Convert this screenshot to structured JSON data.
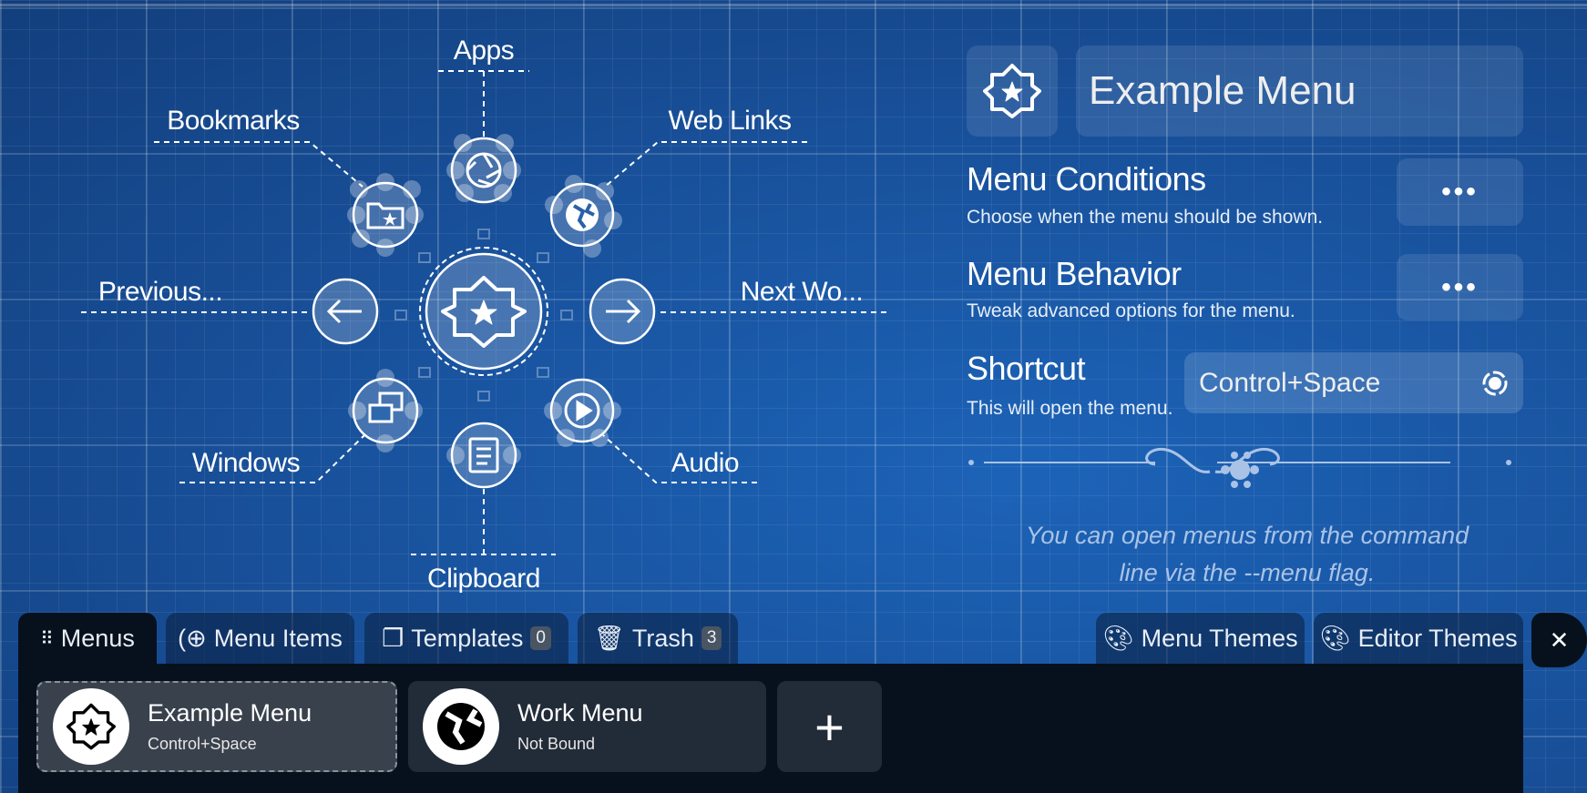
{
  "pie": {
    "center_icon": "star-badge-icon",
    "items": [
      {
        "label": "Apps",
        "icon": "shutter-icon"
      },
      {
        "label": "Web Links",
        "icon": "globe-icon"
      },
      {
        "label": "Next Wo...",
        "icon": "arrow-right-icon"
      },
      {
        "label": "Audio",
        "icon": "play-circle-icon"
      },
      {
        "label": "Clipboard",
        "icon": "clipboard-icon"
      },
      {
        "label": "Windows",
        "icon": "windows-icon"
      },
      {
        "label": "Previous...",
        "icon": "arrow-left-icon"
      },
      {
        "label": "Bookmarks",
        "icon": "folder-star-icon"
      }
    ]
  },
  "properties": {
    "menu_name": "Example Menu",
    "conditions": {
      "title": "Menu Conditions",
      "description": "Choose when the menu should be shown.",
      "button": "•••"
    },
    "behavior": {
      "title": "Menu Behavior",
      "description": "Tweak advanced options for the menu.",
      "button": "•••"
    },
    "shortcut": {
      "title": "Shortcut",
      "description": "This will open the menu.",
      "value": "Control+Space"
    },
    "hint_line1": "You can open menus from the command",
    "hint_line2": "line via the --menu flag."
  },
  "tabs": {
    "menus": "Menus",
    "menu_items": "Menu Items",
    "templates": "Templates",
    "templates_count": "0",
    "trash": "Trash",
    "trash_count": "3",
    "menu_themes": "Menu Themes",
    "editor_themes": "Editor Themes",
    "close": "✕"
  },
  "menus": [
    {
      "name": "Example Menu",
      "shortcut": "Control+Space",
      "selected": true
    },
    {
      "name": "Work Menu",
      "shortcut": "Not Bound",
      "selected": false
    }
  ],
  "add_label": "+"
}
